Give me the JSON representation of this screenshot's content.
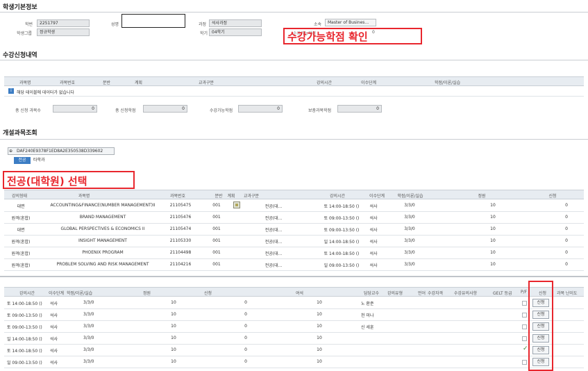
{
  "sections": {
    "student_info": "학생기본정보",
    "enrollment": "수강신청내역",
    "course_search": "개설과목조회"
  },
  "student": {
    "id_label": "학번",
    "id_value": "2251797",
    "name_label": "성명",
    "name_value": "",
    "program_label": "과정",
    "program_value": "석사과정",
    "dept_label": "소속",
    "dept_value": "Master of Busines...",
    "status_label": "학생그룹",
    "status_value": "정규학생",
    "semester_label": "학기",
    "semester_value": "04학기",
    "credits_label": "수강가능학점"
  },
  "annotations": {
    "check_credits": "수강가능학점 확인",
    "select_major": "전공(대학원) 선택"
  },
  "enroll_table": {
    "headers": [
      "과목명",
      "과목번호",
      "분반",
      "계획",
      "교과구분",
      "강의시간",
      "이수단계",
      "학점/이론/실습"
    ],
    "empty_msg": "해당 테이블에 데이터가 없습니다",
    "totals": [
      {
        "label": "총 신청 과목수",
        "value": "0"
      },
      {
        "label": "총 신청학점",
        "value": "0"
      },
      {
        "label": "수강가능학점",
        "value": "0"
      },
      {
        "label": "보충과목학점",
        "value": "0"
      }
    ]
  },
  "search": {
    "code": "DAF240E9378F1ED8A2E350538D339602",
    "tab_major": "전공",
    "tab_other": "타학과"
  },
  "course_table": {
    "headers": [
      "강의형태",
      "과목명",
      "과목번호",
      "분반",
      "계획",
      "교과구분",
      "강의시간",
      "이수단계",
      "학점/이론/실습",
      "정원",
      "신청"
    ],
    "rows": [
      {
        "type": "대면",
        "name": "ACCOUNTING&FINANCE(NUMBER MANAGEMENT)II",
        "num": "21105475",
        "sec": "001",
        "cat": "전공(대...",
        "time": "토 14:00-18:50 ()",
        "stage": "석사",
        "credit": "3/3/0",
        "cap": "10",
        "app": "0"
      },
      {
        "type": "원격(혼합)",
        "name": "BRAND MANAGEMENT",
        "num": "21105476",
        "sec": "001",
        "cat": "전공(대...",
        "time": "토 09:00-13:50 ()",
        "stage": "석사",
        "credit": "3/3/0",
        "cap": "10",
        "app": "0"
      },
      {
        "type": "대면",
        "name": "GLOBAL PERSPECTIVES & ECONOMICS II",
        "num": "21105474",
        "sec": "001",
        "cat": "전공(대...",
        "time": "토 09:00-13:50 ()",
        "stage": "석사",
        "credit": "3/3/0",
        "cap": "10",
        "app": "0"
      },
      {
        "type": "원격(혼합)",
        "name": "INSIGHT MANAGEMENT",
        "num": "21105330",
        "sec": "001",
        "cat": "전공(대...",
        "time": "일 14:00-18:50 ()",
        "stage": "석사",
        "credit": "3/3/0",
        "cap": "10",
        "app": "0"
      },
      {
        "type": "원격(혼합)",
        "name": "PHOENIX PROGRAM",
        "num": "21104498",
        "sec": "001",
        "cat": "전공(대...",
        "time": "토 14:00-18:50 ()",
        "stage": "석사",
        "credit": "3/3/0",
        "cap": "10",
        "app": "0"
      },
      {
        "type": "원격(혼합)",
        "name": "PROBLEM SOLVING AND RISK MANAGEMENT",
        "num": "21104216",
        "sec": "001",
        "cat": "전공(대...",
        "time": "일 09:00-13:50 ()",
        "stage": "석사",
        "credit": "3/3/0",
        "cap": "10",
        "app": "0"
      }
    ]
  },
  "scroll_table": {
    "headers": [
      "강의시간",
      "이수단계",
      "학점/이론/실습",
      "정원",
      "신청",
      "여석",
      "담당교수",
      "강의유형",
      "언어",
      "수강자격",
      "수강유의사항",
      "GELT 등급",
      "P/F",
      "신청",
      "과목 난이도"
    ],
    "rows": [
      {
        "time": "토 14:00-18:50 ()",
        "stage": "석사",
        "credit": "3/3/0",
        "cap": "10",
        "app": "0",
        "seats": "10",
        "prof": "노 환준",
        "pf": false
      },
      {
        "time": "토 09:00-13:50 ()",
        "stage": "석사",
        "credit": "3/3/0",
        "cap": "10",
        "app": "0",
        "seats": "10",
        "prof": "천 미나",
        "pf": false
      },
      {
        "time": "토 09:00-13:50 ()",
        "stage": "석사",
        "credit": "3/3/0",
        "cap": "10",
        "app": "0",
        "seats": "10",
        "prof": "신 세훈",
        "pf": false
      },
      {
        "time": "일 14:00-18:50 ()",
        "stage": "석사",
        "credit": "3/3/0",
        "cap": "10",
        "app": "0",
        "seats": "10",
        "prof": "",
        "pf": false
      },
      {
        "time": "토 14:00-18:50 ()",
        "stage": "석사",
        "credit": "3/3/0",
        "cap": "10",
        "app": "0",
        "seats": "10",
        "prof": "",
        "pf": true
      },
      {
        "time": "일 09:00-13:50 ()",
        "stage": "석사",
        "credit": "3/3/0",
        "cap": "10",
        "app": "0",
        "seats": "10",
        "prof": "",
        "pf": false
      }
    ],
    "apply_label": "신청"
  },
  "colors": {
    "accent_red": "#e8262d",
    "header_bg": "#e7ecf1",
    "tab_blue": "#3c7dc4"
  }
}
